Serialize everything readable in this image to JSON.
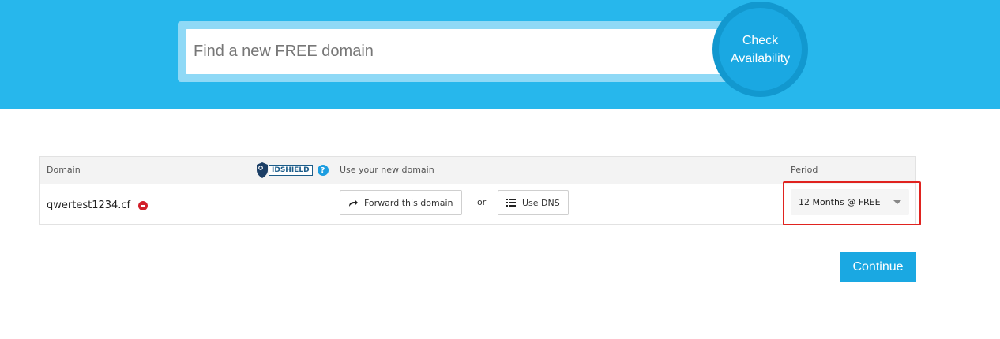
{
  "search": {
    "placeholder": "Find a new FREE domain",
    "button_line1": "Check",
    "button_line2": "Availability"
  },
  "table": {
    "headers": {
      "domain": "Domain",
      "use_new_domain": "Use your new domain",
      "period": "Period"
    },
    "idshield": {
      "label": "IDSHIELD",
      "help": "?"
    },
    "rows": [
      {
        "domain": "qwertest1234.cf",
        "forward_label": "Forward this domain",
        "or_text": "or",
        "dns_label": "Use DNS",
        "period_value": "12 Months @ FREE"
      }
    ]
  },
  "actions": {
    "continue_label": "Continue"
  },
  "colors": {
    "hero_bg": "#27b7ec",
    "accent": "#1aa8e2",
    "highlight": "#e0231f",
    "remove": "#d21f2a"
  },
  "icons": [
    "forward-arrow-icon",
    "list-icon",
    "remove-icon",
    "help-icon",
    "idshield-shield-icon",
    "chevron-down-icon"
  ]
}
